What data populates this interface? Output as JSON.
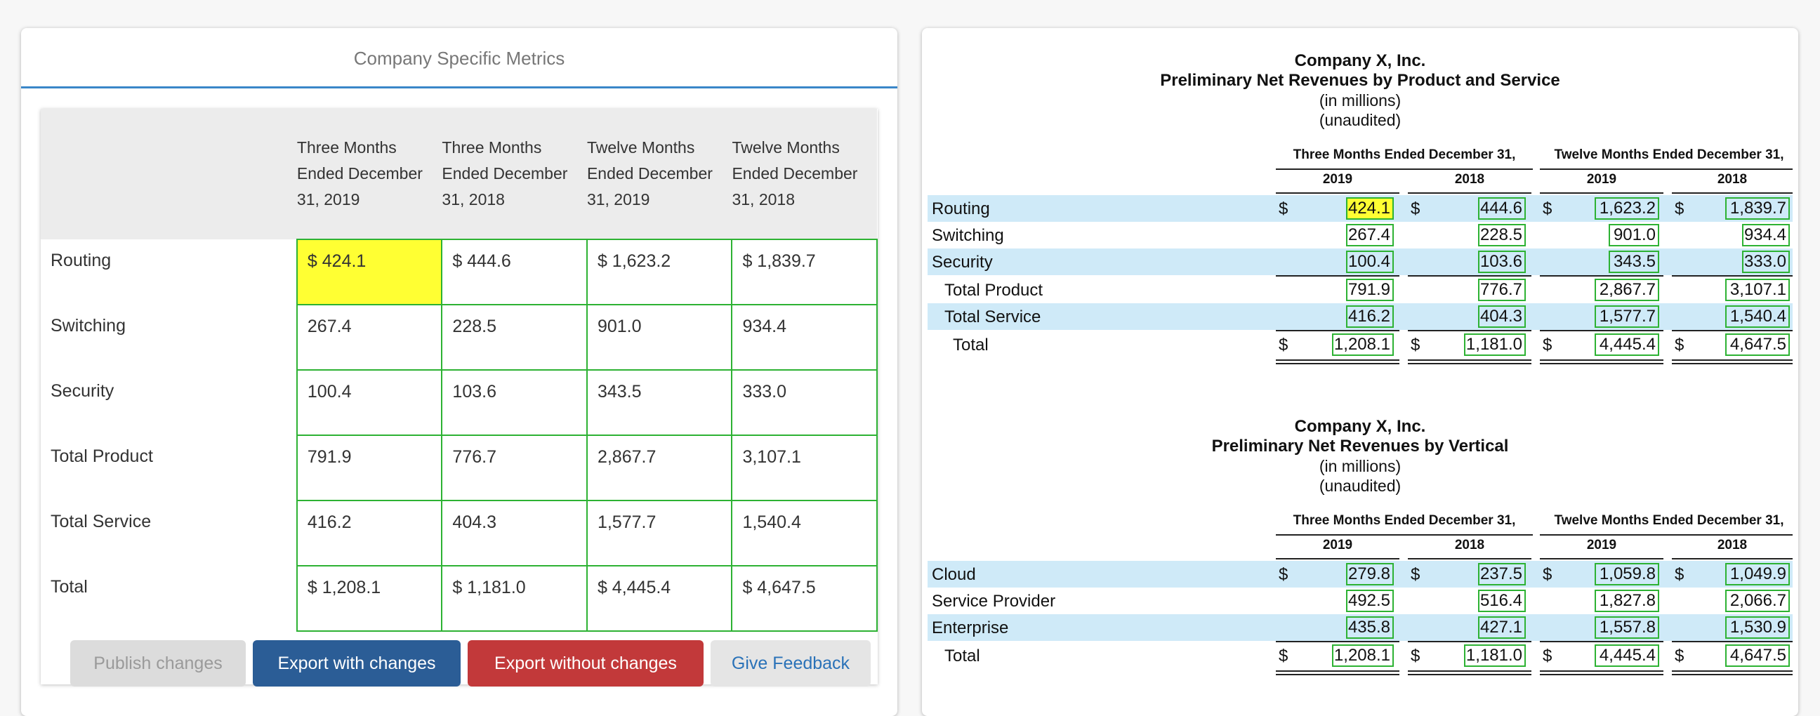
{
  "left": {
    "tab_title": "Company Specific Metrics",
    "columns": [
      "",
      "Three Months Ended December 31, 2019",
      "Three Months Ended December 31, 2018",
      "Twelve Months Ended December 31, 2019",
      "Twelve Months Ended December 31, 2018"
    ],
    "rows": [
      {
        "label": "Routing",
        "v": [
          "$ 424.1",
          "$ 444.6",
          "$ 1,623.2",
          "$ 1,839.7"
        ]
      },
      {
        "label": "Switching",
        "v": [
          "267.4",
          "228.5",
          "901.0",
          "934.4"
        ]
      },
      {
        "label": "Security",
        "v": [
          "100.4",
          "103.6",
          "343.5",
          "333.0"
        ]
      },
      {
        "label": "Total Product",
        "v": [
          "791.9",
          "776.7",
          "2,867.7",
          "3,107.1"
        ]
      },
      {
        "label": "Total Service",
        "v": [
          "416.2",
          "404.3",
          "1,577.7",
          "1,540.4"
        ]
      },
      {
        "label": "Total",
        "v": [
          "$ 1,208.1",
          "$ 1,181.0",
          "$ 4,445.4",
          "$ 4,647.5"
        ]
      }
    ],
    "buttons": {
      "publish": "Publish changes",
      "export_with": "Export with changes",
      "export_without": "Export without changes",
      "feedback": "Give Feedback"
    },
    "colors": {
      "highlight": "#ffff33",
      "cell_border": "#2db233",
      "export_with": "#2b5d96",
      "export_without": "#c2393a"
    }
  },
  "right": {
    "t1": {
      "company": "Company X, Inc.",
      "title": "Preliminary Net Revenues by Product and Service",
      "unit": "(in millions)",
      "audit": "(unaudited)",
      "group1": "Three Months Ended December 31,",
      "group2": "Twelve Months Ended December 31,",
      "years": [
        "2019",
        "2018",
        "2019",
        "2018"
      ],
      "rows": [
        {
          "label": "Routing",
          "v": [
            "424.1",
            "444.6",
            "1,623.2",
            "1,839.7"
          ]
        },
        {
          "label": "Switching",
          "v": [
            "267.4",
            "228.5",
            "901.0",
            "934.4"
          ]
        },
        {
          "label": "Security",
          "v": [
            "100.4",
            "103.6",
            "343.5",
            "333.0"
          ]
        },
        {
          "label": "Total Product",
          "v": [
            "791.9",
            "776.7",
            "2,867.7",
            "3,107.1"
          ]
        },
        {
          "label": "Total Service",
          "v": [
            "416.2",
            "404.3",
            "1,577.7",
            "1,540.4"
          ]
        },
        {
          "label": "Total",
          "v": [
            "1,208.1",
            "1,181.0",
            "4,445.4",
            "4,647.5"
          ]
        }
      ]
    },
    "t2": {
      "company": "Company X, Inc.",
      "title": "Preliminary Net Revenues by Vertical",
      "unit": "(in millions)",
      "audit": "(unaudited)",
      "group1": "Three Months Ended December 31,",
      "group2": "Twelve Months Ended December 31,",
      "years": [
        "2019",
        "2018",
        "2019",
        "2018"
      ],
      "rows": [
        {
          "label": "Cloud",
          "v": [
            "279.8",
            "237.5",
            "1,059.8",
            "1,049.9"
          ]
        },
        {
          "label": "Service Provider",
          "v": [
            "492.5",
            "516.4",
            "1,827.8",
            "2,066.7"
          ]
        },
        {
          "label": "Enterprise",
          "v": [
            "435.8",
            "427.1",
            "1,557.8",
            "1,530.9"
          ]
        },
        {
          "label": "Total",
          "v": [
            "1,208.1",
            "1,181.0",
            "4,445.4",
            "4,647.5"
          ]
        }
      ]
    },
    "currency": "$",
    "colors": {
      "row_shade": "#cfeaf8"
    }
  }
}
